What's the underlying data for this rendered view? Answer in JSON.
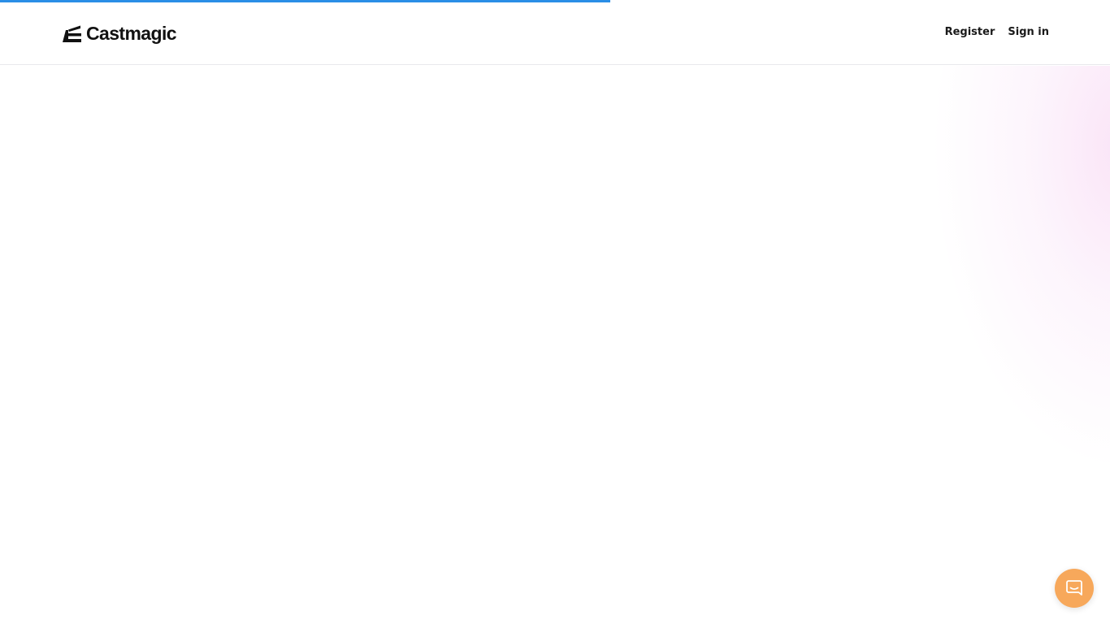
{
  "app": {
    "brand_name": "Castmagic",
    "logo_icon": "castmagic-logo-icon"
  },
  "header": {
    "nav": {
      "register_label": "Register",
      "sign_in_label": "Sign in"
    }
  },
  "loading": {
    "progress": 0.55,
    "color": "#2a8ee6"
  },
  "chat": {
    "icon": "chat-bubble-icon",
    "color": "#f7a85b"
  }
}
